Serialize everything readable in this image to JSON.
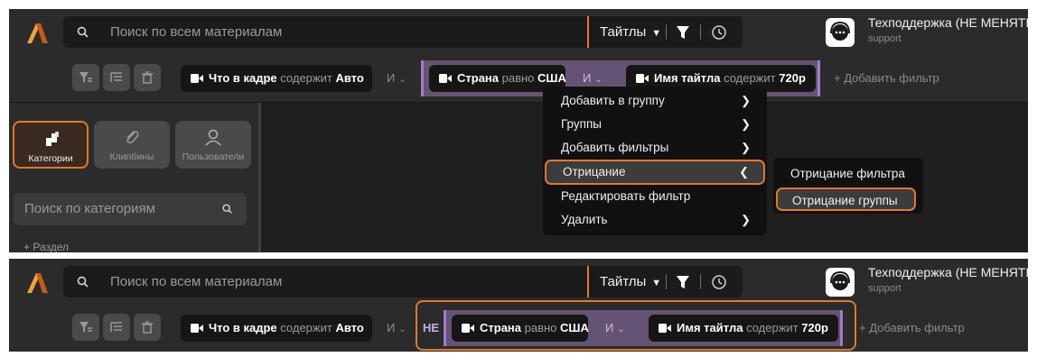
{
  "colors": {
    "accent": "#e0792b",
    "background": "#1f1f20",
    "panel": "#2b2b2c",
    "group": "#655373",
    "group_border": "#a07dc8"
  },
  "header": {
    "search_placeholder": "Поиск по всем материалам",
    "scope_label": "Тайтлы",
    "support_name": "Техподдержка (НЕ МЕНЯТЬ)",
    "support_sub": "support"
  },
  "filters": {
    "chip1": {
      "field": "Что в кадре",
      "op": "содержит",
      "value": "Авто"
    },
    "and_label": "И",
    "chip2": {
      "field": "Страна",
      "op": "равно",
      "value": "США"
    },
    "chip3": {
      "field": "Имя тайтла",
      "op": "содержит",
      "value": "720p"
    },
    "add_filter": "+ Добавить фильтр",
    "not_label": "НЕ"
  },
  "sidebar": {
    "tabs": [
      "Категории",
      "Клипбины",
      "Пользователи"
    ],
    "search_placeholder": "Поиск по категориям",
    "add_section": "+ Раздел"
  },
  "context_menu": {
    "items": [
      "Добавить в группу",
      "Группы",
      "Добавить фильтры",
      "Отрицание",
      "Редактировать фильтр",
      "Удалить"
    ],
    "submenu": [
      "Отрицание фильтра",
      "Отрицание группы"
    ]
  },
  "icons": [
    "logo-icon",
    "search-icon",
    "chevron-down-icon",
    "funnel-icon",
    "clock-icon",
    "headset-icon",
    "filter-group-icon",
    "filter-list-icon",
    "trash-icon",
    "camera-icon",
    "categories-icon",
    "paperclip-icon",
    "user-icon",
    "chevron-right-icon",
    "chevron-left-icon"
  ]
}
